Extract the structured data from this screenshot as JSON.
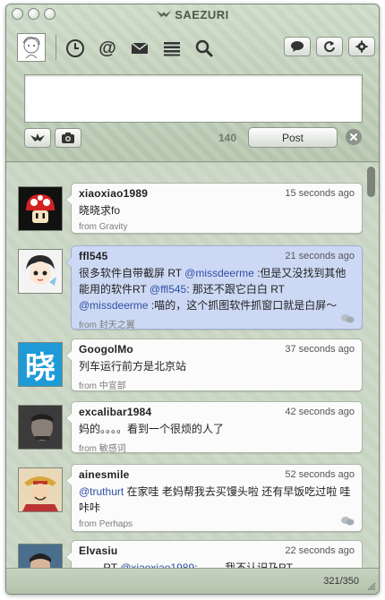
{
  "app": {
    "title": "SAEZURI"
  },
  "toolbar": {
    "nav_icons": [
      "clock-icon",
      "at-icon",
      "envelope-icon",
      "list-icon",
      "search-icon"
    ],
    "right_icons": [
      "speech-bubble-icon",
      "refresh-icon",
      "gear-icon"
    ]
  },
  "compose": {
    "value": "",
    "char_count": "140",
    "post_label": "Post"
  },
  "timeline": {
    "statuses": [
      {
        "user": "xiaoxiao1989",
        "time": "15 seconds ago",
        "text": "晓晓求fo",
        "from": "from Gravity",
        "highlight": false
      },
      {
        "user": "ffl545",
        "time": "21 seconds ago",
        "text_parts": [
          "很多软件自带截屏 RT ",
          "@missdeerme",
          " :但是又没找到其他能用的软件RT ",
          "@ffl545",
          ": 那还不跟它白白 RT ",
          "@missdeerme",
          " :喵的，这个抓图软件抓窗口就是白屏～"
        ],
        "from": "from 封天之翼",
        "highlight": true
      },
      {
        "user": "GoogolMo",
        "time": "37 seconds ago",
        "text": "列车运行前方是北京站",
        "from": "from 中宣部",
        "avatar_char": "晓",
        "highlight": false
      },
      {
        "user": "excalibar1984",
        "time": "42 seconds ago",
        "text": "妈的。。。。看到一个很烦的人了",
        "from": "from 敏感词",
        "highlight": false
      },
      {
        "user": "ainesmile",
        "time": "52 seconds ago",
        "text_parts": [
          "@truthurt",
          " 在家哇 老妈帮我去买馒头啦 还有早饭吃过啦 哇咔咔"
        ],
        "from": "from Perhaps",
        "highlight": false
      },
      {
        "user": "Elvasiu",
        "time": "22 seconds ago",
        "text_parts": [
          "→ →RT ",
          "@xiaoxiao1989",
          ": → →我不认识乃RT"
        ],
        "from": "",
        "highlight": false
      }
    ]
  },
  "footer": {
    "count": "321/350"
  },
  "colors": {
    "mention": "#2f4fa5",
    "highlight_bubble": "#cdd9f4",
    "chrome": "#b9c8b3"
  }
}
